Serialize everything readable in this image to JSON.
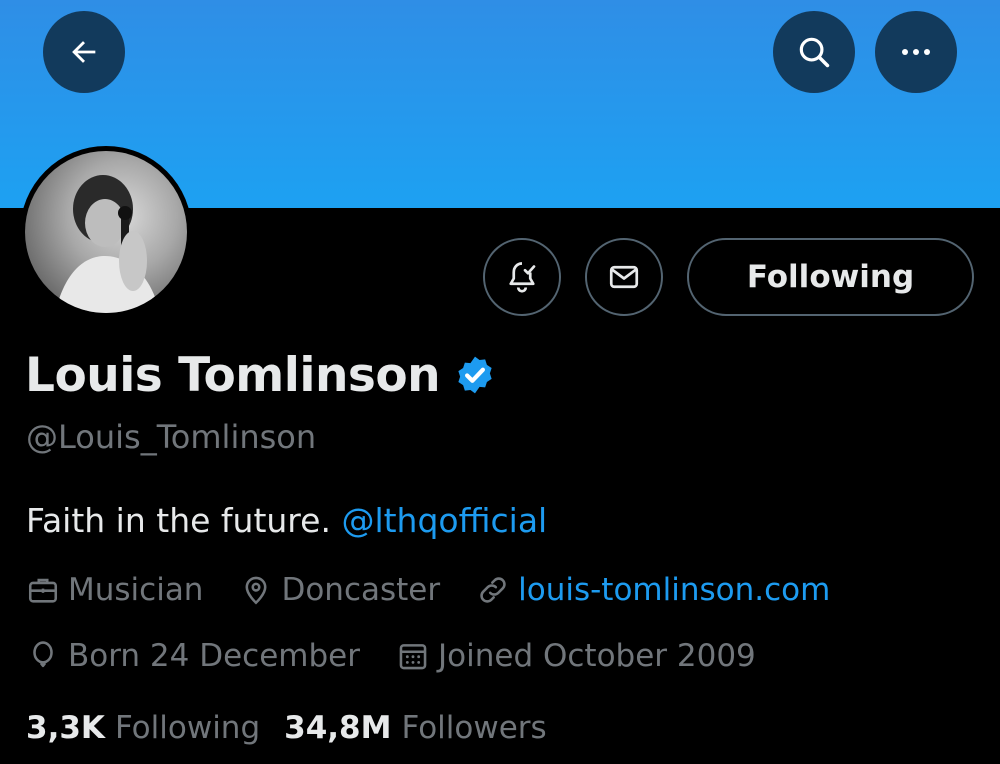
{
  "header": {
    "back_icon": "arrow-left-icon",
    "search_icon": "search-icon",
    "more_icon": "more-horizontal-icon",
    "banner_color": "#1da1f2"
  },
  "profile": {
    "avatar_icon": "avatar",
    "notify_icon": "bell-check-icon",
    "message_icon": "envelope-icon",
    "follow_button_label": "Following",
    "display_name": "Louis Tomlinson",
    "verified_icon": "verified-badge-icon",
    "handle": "@Louis_Tomlinson",
    "bio_text": "Faith in the future.",
    "bio_mention": "@lthqofficial",
    "occupation": "Musician",
    "location": "Doncaster",
    "website": "louis-tomlinson.com",
    "birthday": "Born 24 December",
    "joined": "Joined October 2009"
  },
  "stats": {
    "following_count": "3,3K",
    "following_label": "Following",
    "followers_count": "34,8M",
    "followers_label": "Followers"
  },
  "colors": {
    "accent": "#1d9bf0",
    "muted_text": "#71767b",
    "primary_text": "#e7e9ea",
    "background": "#000000"
  }
}
